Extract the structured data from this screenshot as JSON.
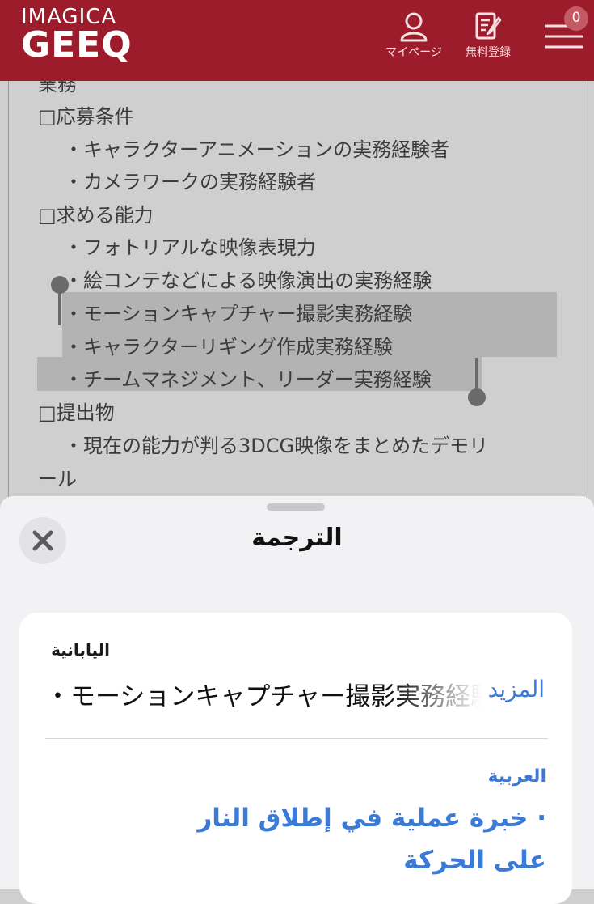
{
  "header": {
    "logo_top": "IMAGICA",
    "logo_bottom": "GEEQ",
    "mypage_label": "マイページ",
    "register_label": "無料登録",
    "cart_count": "0",
    "brand_color": "#9c1c2b"
  },
  "content": {
    "lines": [
      "業務",
      "□応募条件",
      "・キャラクターアニメーションの実務経験者",
      "・カメラワークの実務経験者",
      "□求める能力",
      "・フォトリアルな映像表現力",
      "・絵コンテなどによる映像演出の実務経験",
      "・モーションキャプチャー撮影実務経験",
      "・キャラクターリギング作成実務経験",
      "・チームマネジメント、リーダー実務経験",
      "□提出物",
      "・現在の能力が判る3DCG映像をまとめたデモリ",
      "ール"
    ]
  },
  "sheet": {
    "title": "الترجمة",
    "source_language": "اليابانية",
    "source_text": "・モーションキャプチャー撮影実務経験",
    "more_label": "المزيد",
    "target_language": "العربية",
    "target_text": "· خبرة عملية في إطلاق النار على الحركة",
    "accent_color": "#3a7ad8"
  },
  "icons": {
    "mypage": "user-icon",
    "register": "form-edit-icon",
    "menu": "hamburger-icon",
    "close": "close-icon"
  }
}
